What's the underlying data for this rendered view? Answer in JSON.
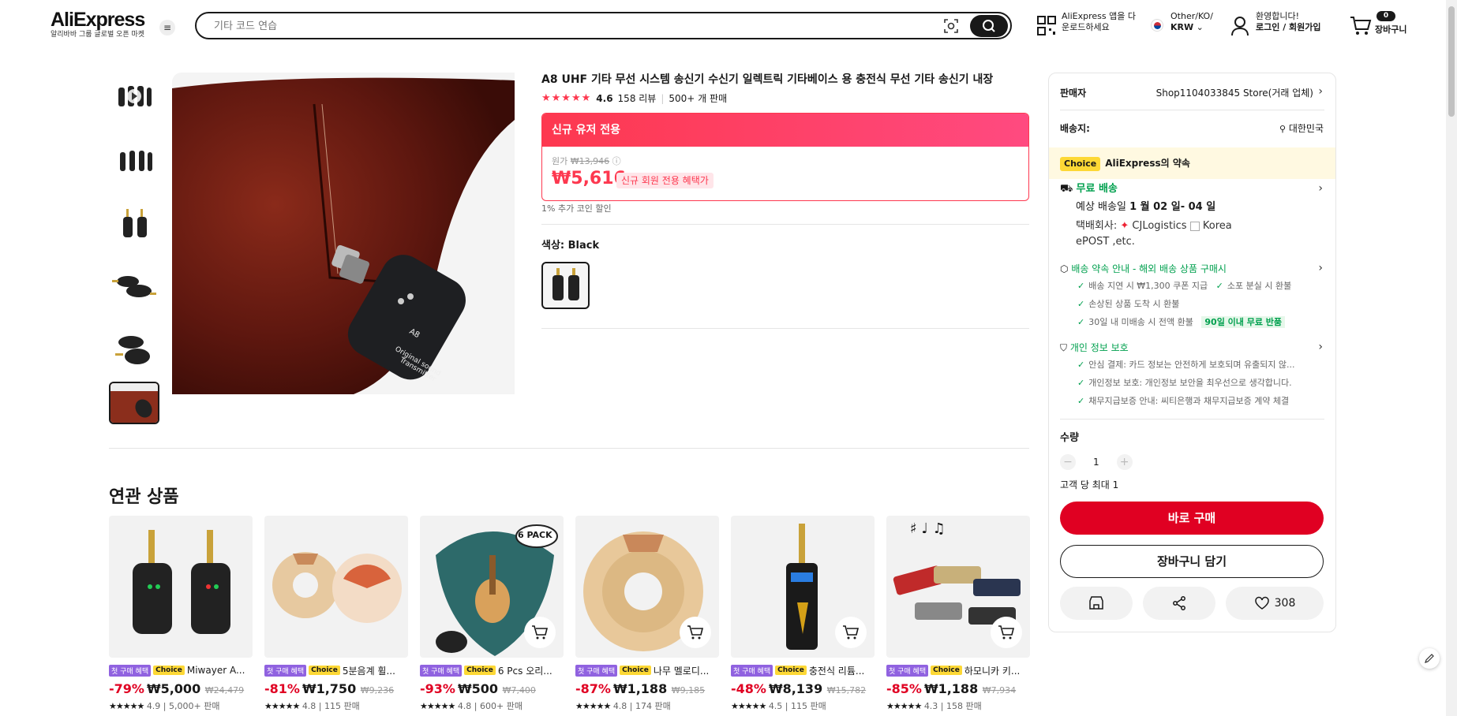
{
  "header": {
    "logo": "AliExpress",
    "logo_tagline": "알리바바 그룹 글로벌 오픈 마켓",
    "search_placeholder": "기타 코드 연습",
    "app_download": [
      "AliExpress 앱을 다",
      "운로드하세요"
    ],
    "region": "Other/KO/",
    "currency": "KRW",
    "welcome": "환영합니다!",
    "login": "로그인 / 회원가입",
    "cart_count": "0",
    "cart_label": "장바구니"
  },
  "product": {
    "title": "A8 UHF 기타 무선 시스템 송신기 수신기 일렉트릭 기타베이스 용 충전식 무선 기타 송신기 내장",
    "rating": "4.6",
    "reviews": "158 리뷰",
    "sold": "500+ 개 판매",
    "promo_banner": "신규 유저 전용",
    "original_label": "원가",
    "original_price": "₩13,946",
    "price": "₩5,616",
    "price_pill": "신규 회원 전용 혜택가",
    "coin_note": "1% 추가 코인 할인",
    "color_label": "색상: Black"
  },
  "panel": {
    "seller_label": "판매자",
    "seller_name": "Shop1104033845 Store(거래 업체)",
    "ship_to_label": "배송지:",
    "ship_to": "대한민국",
    "choice_tag": "Choice",
    "choice_promise": "AliExpress의 약속",
    "free_shipping": "무료 배송",
    "delivery_prefix": "예상 배송일",
    "delivery_date": "1 월 02 일- 04 일",
    "courier_label": "택배회사:",
    "courier_1": "CJLogistics",
    "courier_2": "Korea",
    "courier_3": "ePOST ,etc.",
    "promise_title": "배송 약속 안내 - 해외 배송 상품 구매시",
    "promise_items": [
      "배송 지연 시 ₩1,300 쿠폰 지급",
      "소포 분실 시 환불",
      "손상된 상품 도착 시 환불",
      "30일 내 미배송 시 전액 환불"
    ],
    "return_tag": "90일 이내 무료 반품",
    "privacy_title": "개인 정보 보호",
    "privacy_items": [
      "안심 결제: 카드 정보는 안전하게 보호되며 유출되지 않...",
      "개인정보 보호: 개인정보 보안을 최우선으로 생각합니다.",
      "채무지급보증 안내: 씨티은행과 채무지급보증 계약 체결"
    ],
    "qty_label": "수량",
    "qty_value": "1",
    "qty_limit": "고객 당 최대 1",
    "buy_now": "바로 구매",
    "add_to_cart": "장바구니 담기",
    "wishlist_count": "308"
  },
  "related": {
    "title": "연관 상품",
    "first_tag": "첫 구매 혜택",
    "choice_tag": "Choice",
    "items": [
      {
        "name": "Miwayer A...",
        "discount": "-79%",
        "price": "₩5,000",
        "orig": "₩24,479",
        "rating": "4.9",
        "sold": "5,000+ 판매"
      },
      {
        "name": "5분음계 휠...",
        "discount": "-81%",
        "price": "₩1,750",
        "orig": "₩9,236",
        "rating": "4.8",
        "sold": "115 판매"
      },
      {
        "name": "6 Pcs 오리...",
        "discount": "-93%",
        "price": "₩500",
        "orig": "₩7,400",
        "rating": "4.8",
        "sold": "600+ 판매"
      },
      {
        "name": "나무 멜로디...",
        "discount": "-87%",
        "price": "₩1,188",
        "orig": "₩9,185",
        "rating": "4.8",
        "sold": "174 판매"
      },
      {
        "name": "충전식 리튬...",
        "discount": "-48%",
        "price": "₩8,139",
        "orig": "₩15,782",
        "rating": "4.5",
        "sold": "115 판매"
      },
      {
        "name": "하모니카 키...",
        "discount": "-85%",
        "price": "₩1,188",
        "orig": "₩7,934",
        "rating": "4.3",
        "sold": "158 판매"
      }
    ],
    "pack_badge": "6 PACK"
  },
  "colors": {
    "accent": "#fd384f",
    "buy": "#e00022",
    "green": "#00a04e",
    "choice": "#fdd835"
  }
}
